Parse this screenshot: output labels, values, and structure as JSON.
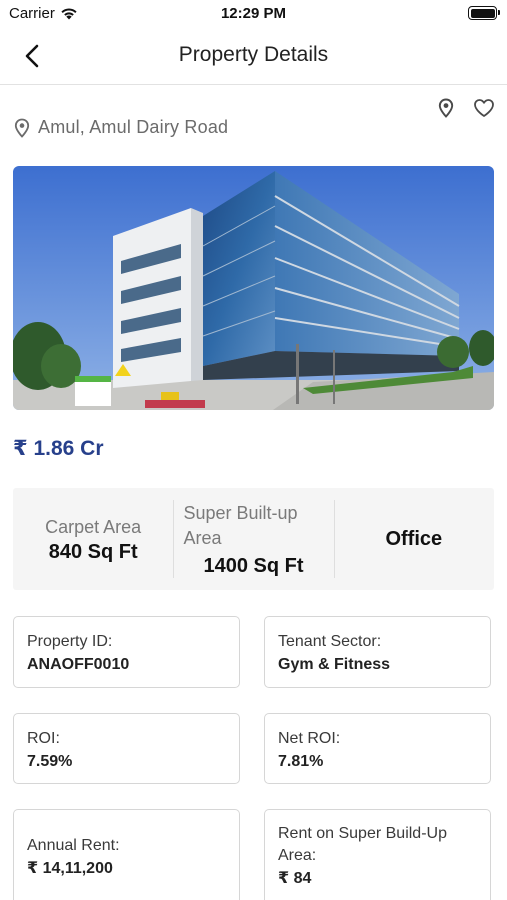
{
  "status_bar": {
    "carrier": "Carrier",
    "time": "12:29 PM"
  },
  "nav": {
    "title": "Property Details",
    "back_icon": "chevron-left-icon"
  },
  "location": {
    "icon": "location-pin-icon",
    "text": "Amul, Amul Dairy Road"
  },
  "actions": {
    "map_icon": "location-pin-icon",
    "favorite_icon": "heart-outline-icon"
  },
  "hero_image": {
    "subject": "modern-glass-office-building"
  },
  "price": "₹ 1.86 Cr",
  "stats": {
    "carpet_area_label": "Carpet Area",
    "carpet_area_value": "840 Sq Ft",
    "super_builtup_label": "Super Built-up Area",
    "super_builtup_value": "1400 Sq Ft",
    "property_type": "Office"
  },
  "details": {
    "property_id": {
      "label": "Property ID:",
      "value": "ANAOFF0010"
    },
    "tenant_sector": {
      "label": "Tenant Sector:",
      "value": "Gym & Fitness"
    },
    "roi": {
      "label": "ROI:",
      "value": "7.59%"
    },
    "net_roi": {
      "label": "Net ROI:",
      "value": "7.81%"
    },
    "annual_rent": {
      "label": "Annual Rent:",
      "value": "₹ 14,11,200"
    },
    "rent_on_super": {
      "label": "Rent on Super Build-Up Area:",
      "value": "₹ 84"
    }
  },
  "colors": {
    "price": "#27408b",
    "panel_bg": "#f5f5f5",
    "card_border": "#d6d6d6"
  }
}
